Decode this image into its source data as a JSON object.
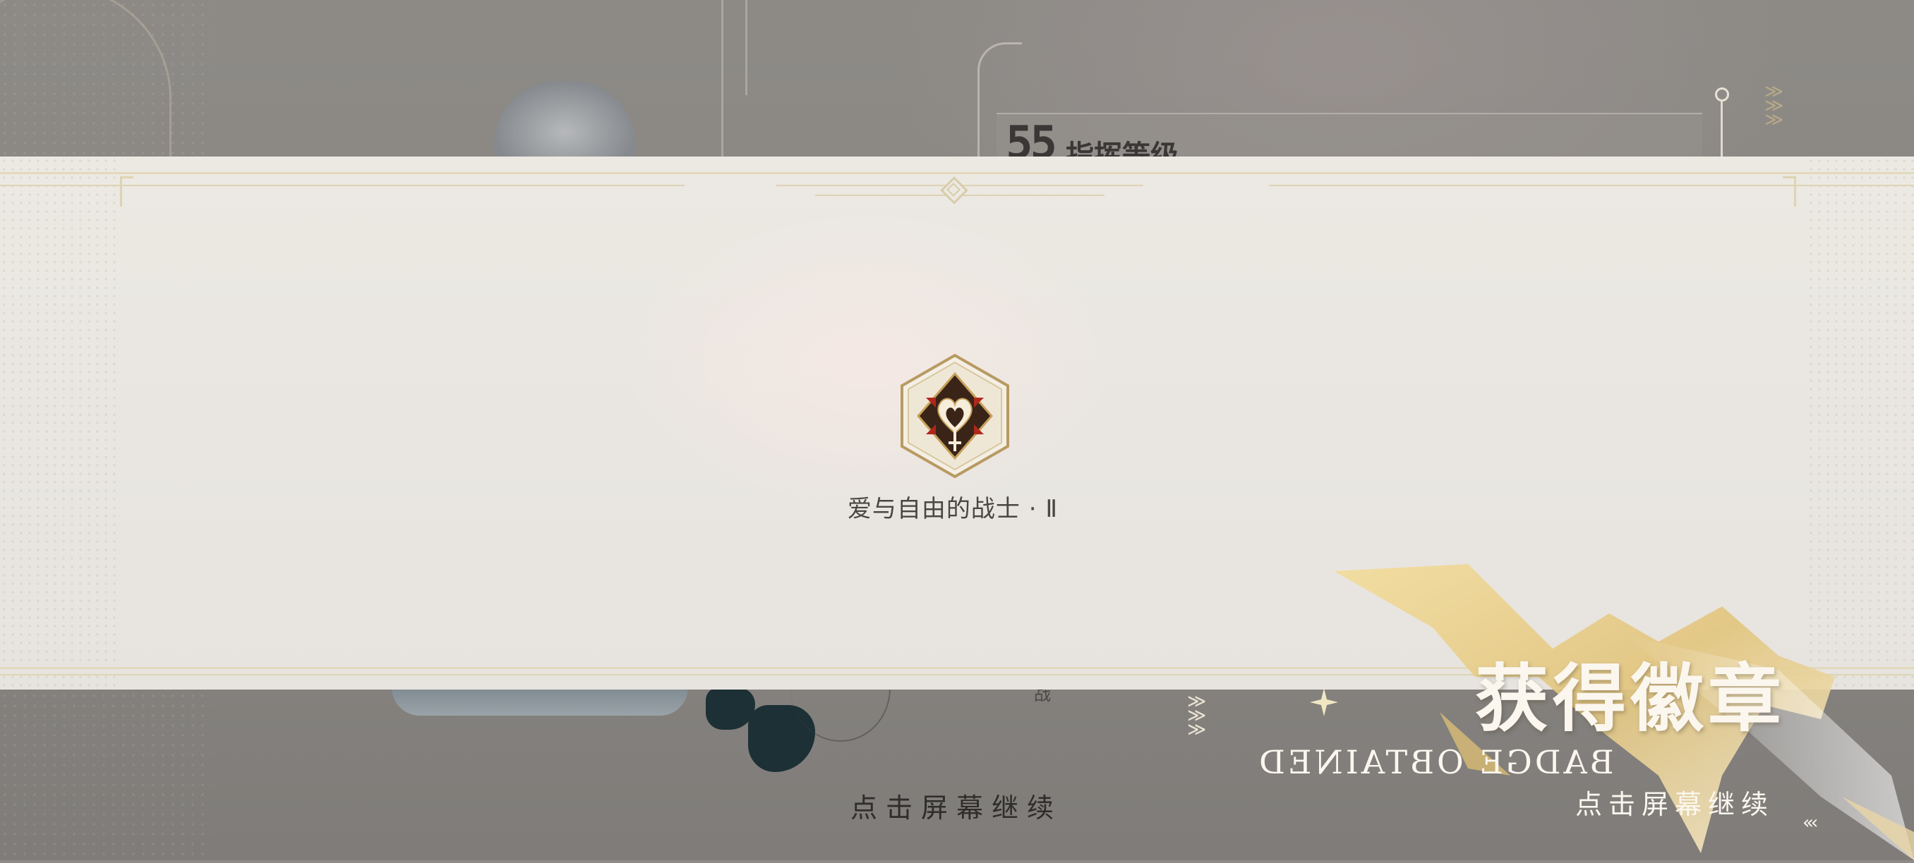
{
  "background": {
    "level_number": "55",
    "level_label": "指挥等级",
    "partial_text": "战"
  },
  "reward": {
    "badge_name": "爱与自由的战士 · Ⅱ",
    "title": "获得徽章",
    "subtitle_mirrored": "BADGE OBTAINED",
    "tap_to_continue_center": "点击屏幕继续",
    "tap_to_continue_right": "点击屏幕继续"
  },
  "icons": [
    "badge-icon",
    "star-icon",
    "chevron-down-icon",
    "back-chevron-icon"
  ],
  "colors": {
    "panel": "#ece9e3",
    "gold_accent": "#d8cca8",
    "badge_dark": "#3a2418",
    "badge_red": "#b0271c",
    "text_light": "#fbf7ef"
  }
}
